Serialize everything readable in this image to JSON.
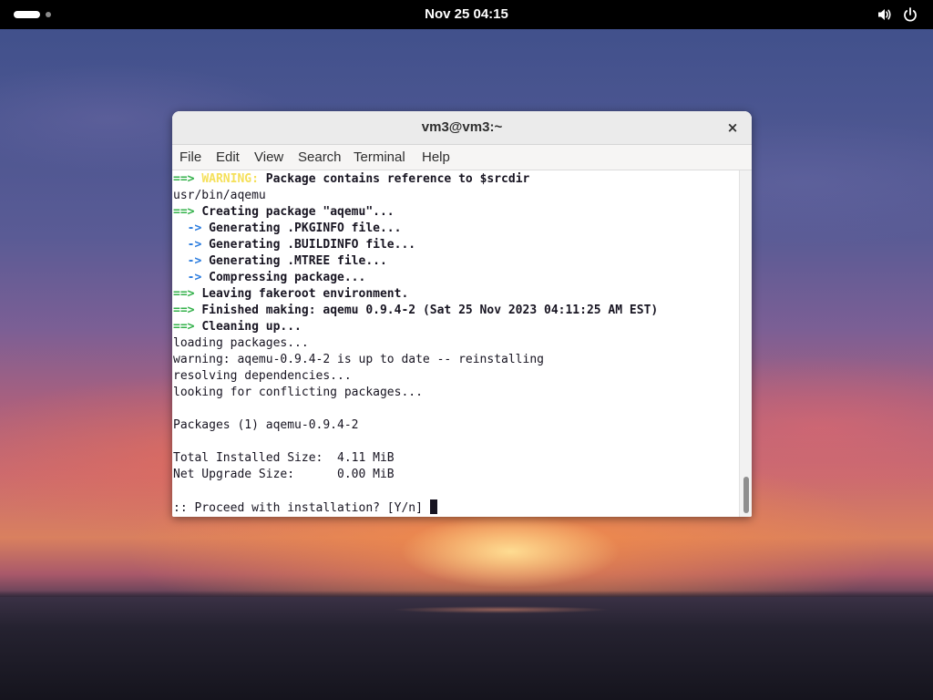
{
  "desktop": {
    "clock": "Nov 25  04:15",
    "tray_icons": [
      "volume-icon",
      "power-icon"
    ]
  },
  "window": {
    "title": "vm3@vm3:~",
    "close_label": "×",
    "menu": [
      "File",
      "Edit",
      "View",
      "Search",
      "Terminal",
      "Help"
    ]
  },
  "terminal": {
    "lines": [
      {
        "prefix": "==> ",
        "tag": "WARNING:",
        "text": " Package contains reference to $srcdir"
      },
      {
        "text": "usr/bin/aqemu"
      },
      {
        "prefix": "==> ",
        "text": "Creating package \"aqemu\"..."
      },
      {
        "prefix": "  -> ",
        "text": "Generating .PKGINFO file..."
      },
      {
        "prefix": "  -> ",
        "text": "Generating .BUILDINFO file..."
      },
      {
        "prefix": "  -> ",
        "text": "Generating .MTREE file..."
      },
      {
        "prefix": "  -> ",
        "text": "Compressing package..."
      },
      {
        "prefix": "==> ",
        "text": "Leaving fakeroot environment."
      },
      {
        "prefix": "==> ",
        "text": "Finished making: aqemu 0.9.4-2 (Sat 25 Nov 2023 04:11:25 AM EST)"
      },
      {
        "prefix": "==> ",
        "text": "Cleaning up..."
      },
      {
        "text": "loading packages..."
      },
      {
        "text": "warning: aqemu-0.9.4-2 is up to date -- reinstalling"
      },
      {
        "text": "resolving dependencies..."
      },
      {
        "text": "looking for conflicting packages..."
      },
      {
        "text": ""
      },
      {
        "text": "Packages (1) aqemu-0.9.4-2"
      },
      {
        "text": ""
      },
      {
        "text": "Total Installed Size:  4.11 MiB"
      },
      {
        "text": "Net Upgrade Size:      0.00 MiB"
      },
      {
        "text": ""
      },
      {
        "text": ":: Proceed with installation? [Y/n] "
      }
    ]
  },
  "colors": {
    "topbar": "#000000",
    "titlebar": "#ebebeb",
    "terminal_bg": "#ffffff",
    "terminal_fg": "#171421",
    "arrow_green": "#26a269",
    "arrow_blue": "#2a7bde",
    "warning_yellow": "#f5e05a"
  }
}
